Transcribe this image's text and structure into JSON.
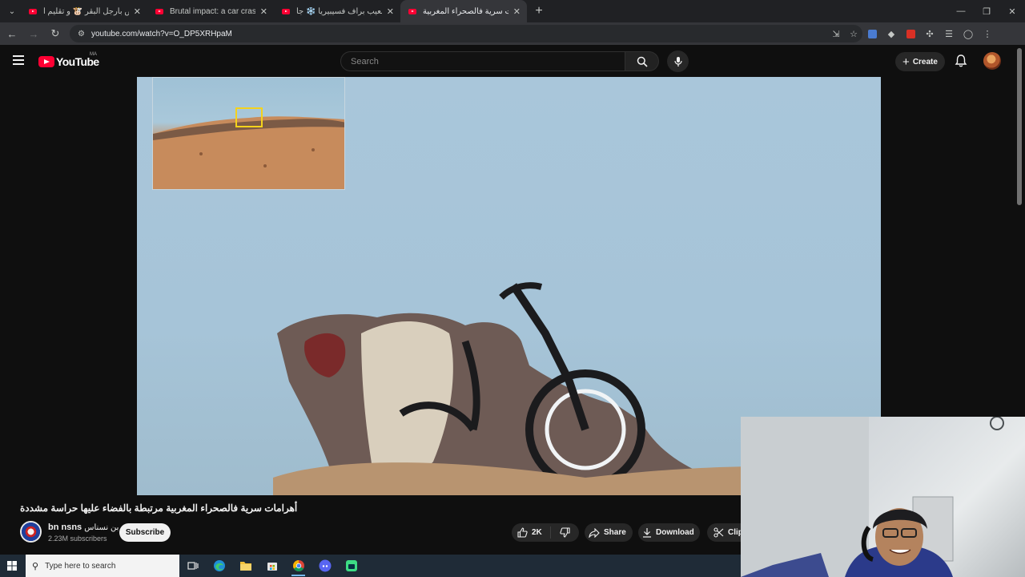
{
  "browser": {
    "tabs": [
      {
        "title": "الحمص بأرجل البقر 🐮 و تقليم أ",
        "active": false
      },
      {
        "title": "Brutal impact: a car crashes",
        "active": false
      },
      {
        "title": "نهار صعيب براف فسيبيريا ❄️ جا",
        "active": false
      },
      {
        "title": "أهرامات سرية فالصحراء المغربية",
        "active": true
      }
    ],
    "url": "youtube.com/watch?v=O_DP5XRHpaM",
    "accent": "#ff0033"
  },
  "masthead": {
    "logo_text": "YouTube",
    "country_code": "MA",
    "search_placeholder": "Search",
    "create_label": "Create"
  },
  "video": {
    "title": "أهرامات سرية فالصحراء المغربية مرتبطة بالفضاء عليها حراسة مشددة",
    "channel": {
      "name": "bn nsns",
      "name_suffix": "بن نسناس",
      "subscribers": "2.23M subscribers"
    },
    "subscribe_label": "Subscribe",
    "actions": {
      "likes": "2K",
      "share": "Share",
      "download": "Download",
      "clip": "Clip"
    }
  },
  "taskbar": {
    "search_placeholder": "Type here to search",
    "apps": [
      "task-view-icon",
      "edge-icon",
      "file-explorer-icon",
      "store-icon",
      "chrome-icon",
      "discord-icon",
      "android-studio-icon"
    ]
  }
}
